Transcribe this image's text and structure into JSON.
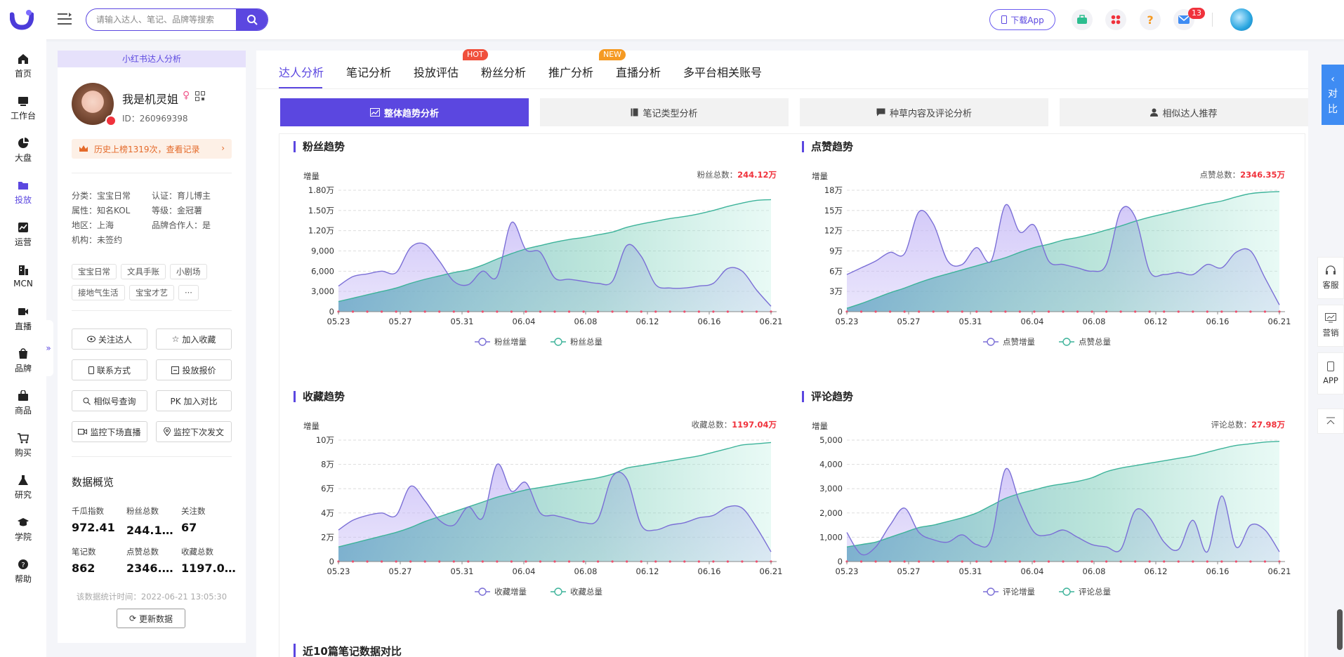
{
  "header": {
    "search_placeholder": "请输入达人、笔记、品牌等搜索",
    "download_app_label": "下载App",
    "mail_badge": "13"
  },
  "nav": [
    {
      "label": "首页",
      "icon": "home-icon"
    },
    {
      "label": "工作台",
      "icon": "workbench-icon"
    },
    {
      "label": "大盘",
      "icon": "pie-chart-icon"
    },
    {
      "label": "投放",
      "icon": "folder-icon"
    },
    {
      "label": "运营",
      "icon": "trend-icon"
    },
    {
      "label": "MCN",
      "icon": "building-icon"
    },
    {
      "label": "直播",
      "icon": "video-icon"
    },
    {
      "label": "品牌",
      "icon": "brand-icon"
    },
    {
      "label": "商品",
      "icon": "bag-icon"
    },
    {
      "label": "购买",
      "icon": "cart-icon"
    },
    {
      "label": "研究",
      "icon": "flask-icon"
    },
    {
      "label": "学院",
      "icon": "graduation-cap-icon"
    },
    {
      "label": "帮助",
      "icon": "help-icon"
    }
  ],
  "active_nav": "投放",
  "profile": {
    "card_title": "小红书达人分析",
    "name": "我是机灵姐",
    "id": "ID：260969398",
    "rank_text": "历史上榜1319次，查看记录",
    "attrs": {
      "category": "分类：宝宝日常",
      "cert": "认证：育儿博主",
      "type": "属性：知名KOL",
      "level": "等级：金冠薯",
      "region": "地区：上海",
      "brand_partner": "品牌合作人：是",
      "org": "机构：未签约"
    },
    "tags": [
      "宝宝日常",
      "文具手账",
      "小剧场",
      "接地气生活",
      "宝宝才艺",
      "···"
    ],
    "actions": {
      "follow": "关注达人",
      "favorite": "加入收藏",
      "contact": "联系方式",
      "quote": "投放报价",
      "similar": "相似号查询",
      "compare": "PK 加入对比",
      "monitor_live": "监控下场直播",
      "monitor_post": "监控下次发文"
    },
    "overview_title": "数据概览",
    "overview": [
      {
        "label": "千瓜指数",
        "value": "972.41"
      },
      {
        "label": "粉丝总数",
        "value": "244.12万"
      },
      {
        "label": "关注数",
        "value": "67"
      },
      {
        "label": "笔记数",
        "value": "862"
      },
      {
        "label": "点赞总数",
        "value": "2346.3..."
      },
      {
        "label": "收藏总数",
        "value": "1197.0..."
      }
    ],
    "stat_time": "该数据统计时间：2022-06-21 13:05:30",
    "refresh": "更新数据"
  },
  "tabs": [
    {
      "label": "达人分析"
    },
    {
      "label": "笔记分析"
    },
    {
      "label": "投放评估"
    },
    {
      "label": "粉丝分析",
      "badge": "HOT",
      "badge_color": "#f0503c"
    },
    {
      "label": "推广分析"
    },
    {
      "label": "直播分析",
      "badge": "NEW",
      "badge_color": "#f59a23"
    },
    {
      "label": "多平台相关账号"
    }
  ],
  "subtabs": [
    "整体趋势分析",
    "笔记类型分析",
    "种草内容及评论分析",
    "相似达人推荐"
  ],
  "next_section_title": "近10篇笔记数据对比",
  "side": {
    "compare": [
      "对",
      "比"
    ],
    "service": "客服",
    "marketing": "营销",
    "app": "APP"
  },
  "colors": {
    "accent": "#5b47e0",
    "increment": "#7b6fd6",
    "total": "#3db39a",
    "badge_red": "#f0323c"
  },
  "chart_data": [
    {
      "type": "area",
      "title": "粉丝趋势",
      "ylabel": "增量",
      "total_label": "粉丝总数：",
      "total_value": "244.12万",
      "x_ticks": [
        "05.23",
        "05.27",
        "05.31",
        "06.04",
        "06.08",
        "06.12",
        "06.16",
        "06.21"
      ],
      "y_ticks": [
        "0",
        "3,000",
        "6,000",
        "9,000",
        "1.20万",
        "1.50万",
        "1.80万"
      ],
      "ylim": [
        0,
        18000
      ],
      "series": [
        {
          "name": "粉丝增量",
          "values": [
            3800,
            5200,
            5600,
            6000,
            5800,
            9500,
            10000,
            7500,
            4500,
            4000,
            6000,
            5200,
            13200,
            9200,
            8800,
            5000,
            4800,
            4500,
            4200,
            4500,
            9800,
            8200,
            4000,
            3500,
            3500,
            3800,
            4200,
            6400,
            6000,
            3200,
            800
          ]
        },
        {
          "name": "粉丝总量",
          "values": [
            1500,
            2000,
            2500,
            3000,
            3500,
            4200,
            4800,
            5300,
            5800,
            6200,
            6900,
            7800,
            8600,
            9300,
            9800,
            10300,
            10700,
            11000,
            11400,
            11800,
            12500,
            13000,
            13400,
            13800,
            14100,
            14500,
            15000,
            15600,
            16100,
            16500,
            16600
          ]
        }
      ],
      "legend": "bottom"
    },
    {
      "type": "area",
      "title": "点赞趋势",
      "ylabel": "增量",
      "total_label": "点赞总数：",
      "total_value": "2346.35万",
      "x_ticks": [
        "05.23",
        "05.27",
        "05.31",
        "06.04",
        "06.08",
        "06.12",
        "06.16",
        "06.21"
      ],
      "y_ticks": [
        "0",
        "3万",
        "6万",
        "9万",
        "12万",
        "15万",
        "18万"
      ],
      "ylim": [
        0,
        180000
      ],
      "series": [
        {
          "name": "点赞增量",
          "values": [
            55000,
            65000,
            75000,
            88000,
            86000,
            148000,
            130000,
            75000,
            70000,
            95000,
            75000,
            158000,
            118000,
            128000,
            75000,
            70000,
            65000,
            60000,
            70000,
            150000,
            140000,
            60000,
            55000,
            58000,
            55000,
            70000,
            65000,
            88000,
            90000,
            50000,
            10000
          ]
        },
        {
          "name": "点赞总量",
          "values": [
            5000,
            12000,
            20000,
            28000,
            35000,
            43000,
            50000,
            56000,
            62000,
            68000,
            74000,
            80000,
            88000,
            95000,
            100000,
            106000,
            110000,
            115000,
            121000,
            127000,
            134000,
            140000,
            145000,
            150000,
            155000,
            160000,
            164000,
            170000,
            175000,
            177000,
            178000
          ]
        }
      ],
      "legend": "bottom"
    },
    {
      "type": "area",
      "title": "收藏趋势",
      "ylabel": "增量",
      "total_label": "收藏总数：",
      "total_value": "1197.04万",
      "x_ticks": [
        "05.23",
        "05.27",
        "05.31",
        "06.04",
        "06.08",
        "06.12",
        "06.16",
        "06.21"
      ],
      "y_ticks": [
        "0",
        "2万",
        "4万",
        "6万",
        "8万",
        "10万"
      ],
      "ylim": [
        0,
        100000
      ],
      "series": [
        {
          "name": "收藏增量",
          "values": [
            26000,
            34000,
            38000,
            40000,
            38000,
            62000,
            50000,
            34000,
            30000,
            45000,
            36000,
            80000,
            58000,
            65000,
            40000,
            38000,
            35000,
            32000,
            35000,
            70000,
            68000,
            30000,
            26000,
            30000,
            32000,
            36000,
            38000,
            45000,
            44000,
            28000,
            8000
          ]
        },
        {
          "name": "收藏总量",
          "values": [
            12000,
            15000,
            18000,
            21000,
            24000,
            28000,
            33000,
            37000,
            41000,
            45000,
            49000,
            53000,
            56000,
            59000,
            61000,
            63000,
            65000,
            67000,
            69000,
            72000,
            77000,
            79000,
            81000,
            83000,
            85000,
            87000,
            90000,
            93000,
            96000,
            97000,
            98000
          ]
        }
      ],
      "legend": "bottom"
    },
    {
      "type": "area",
      "title": "评论趋势",
      "ylabel": "增量",
      "total_label": "评论总数：",
      "total_value": "27.98万",
      "x_ticks": [
        "05.23",
        "05.27",
        "05.31",
        "06.04",
        "06.08",
        "06.12",
        "06.16",
        "06.21"
      ],
      "y_ticks": [
        "0",
        "1,000",
        "2,000",
        "3,000",
        "4,000",
        "5,000"
      ],
      "ylim": [
        0,
        5000
      ],
      "series": [
        {
          "name": "评论增量",
          "values": [
            1200,
            300,
            600,
            1500,
            2200,
            1200,
            900,
            800,
            1100,
            700,
            900,
            3800,
            2400,
            1200,
            1100,
            1300,
            1000,
            700,
            600,
            500,
            2100,
            1800,
            800,
            500,
            1700,
            400,
            2700,
            600,
            1500,
            1300,
            400
          ]
        },
        {
          "name": "评论总量",
          "values": [
            600,
            700,
            800,
            1000,
            1200,
            1400,
            1500,
            1650,
            1800,
            2000,
            2300,
            2600,
            2800,
            2950,
            3100,
            3200,
            3300,
            3450,
            3700,
            3850,
            3950,
            4050,
            4150,
            4250,
            4350,
            4500,
            4650,
            4780,
            4850,
            4920,
            4950
          ]
        }
      ],
      "legend": "bottom"
    }
  ]
}
